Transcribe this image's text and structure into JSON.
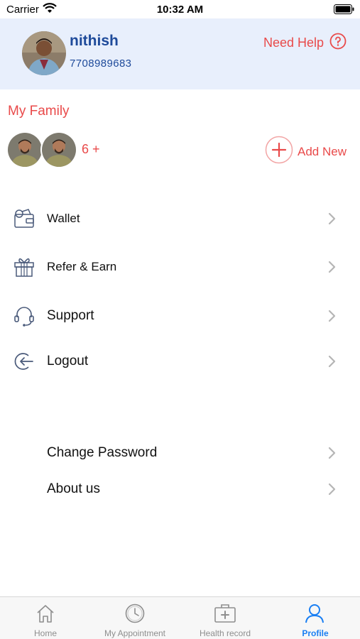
{
  "status_bar": {
    "carrier": "Carrier",
    "time": "10:32 AM"
  },
  "profile": {
    "name": "nithish",
    "phone": "7708989683",
    "need_help": "Need Help"
  },
  "family": {
    "title": "My Family",
    "count": "6 +",
    "add_new": "Add New"
  },
  "menu": {
    "wallet": "Wallet",
    "refer": "Refer & Earn",
    "support": "Support",
    "logout": "Logout",
    "change_password": "Change Password",
    "about": "About us"
  },
  "tabs": {
    "home": "Home",
    "appointment": "My Appointment",
    "health": "Health record",
    "profile": "Profile"
  },
  "colors": {
    "accent": "#e94a4a",
    "header_bg": "#e8effc",
    "name_blue": "#1e4a9a",
    "active_tab": "#1a7ff3"
  }
}
